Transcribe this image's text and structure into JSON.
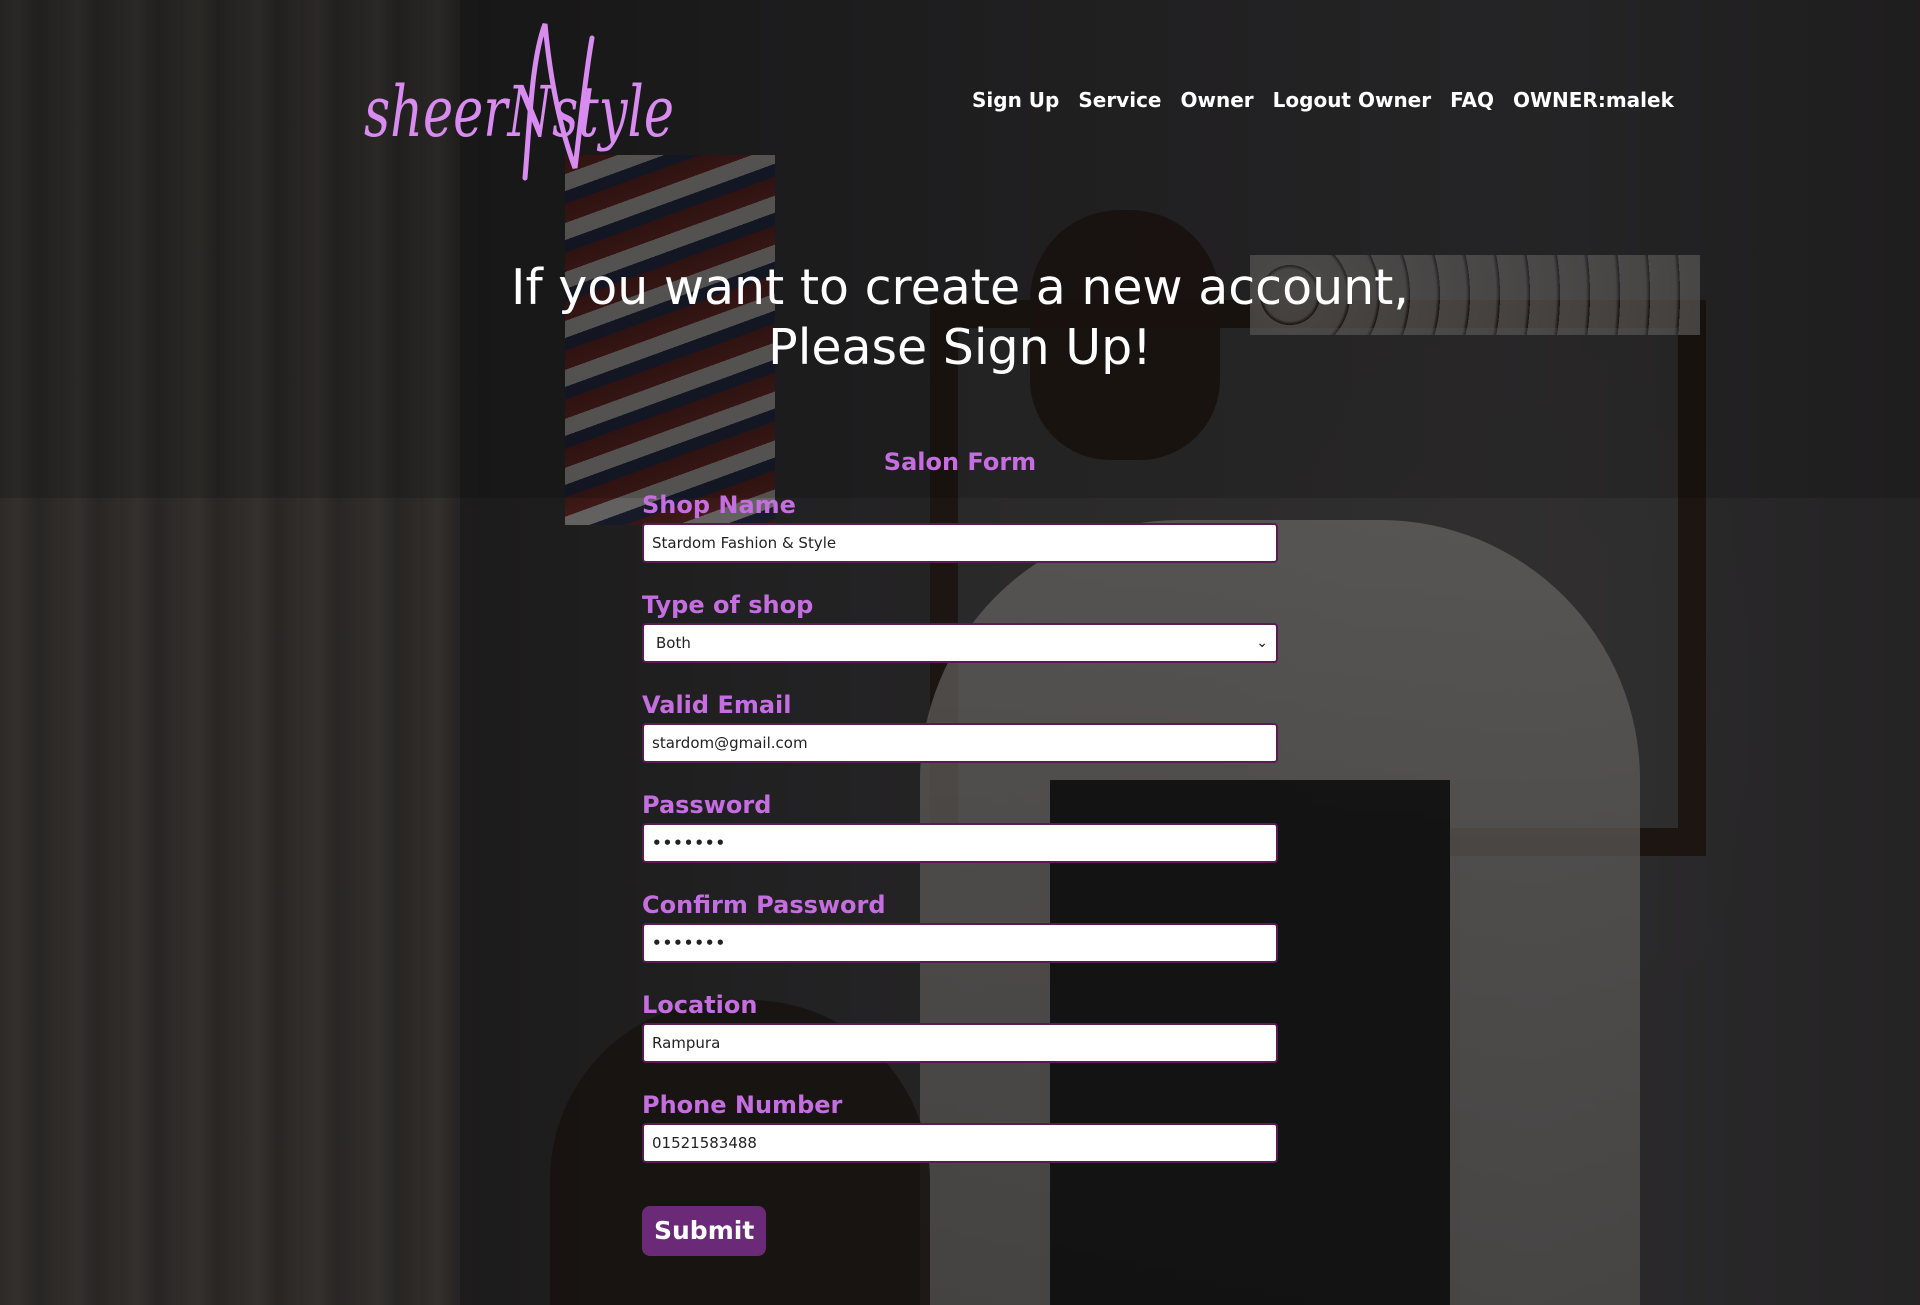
{
  "brand": {
    "logo_text": "sheerNstyle",
    "logo_color": "#d98cf0"
  },
  "nav": {
    "items": [
      {
        "label": "Sign Up"
      },
      {
        "label": "Service"
      },
      {
        "label": "Owner"
      },
      {
        "label": "Logout Owner"
      },
      {
        "label": "FAQ"
      },
      {
        "label": "OWNER:malek"
      }
    ]
  },
  "headline": {
    "line1": "If you want to create a new account,",
    "line2": "Please Sign Up!"
  },
  "form": {
    "title": "Salon Form",
    "fields": {
      "shop_name": {
        "label": "Shop Name",
        "value": "Stardom Fashion & Style"
      },
      "shop_type": {
        "label": "Type of shop",
        "value": "Both"
      },
      "email": {
        "label": "Valid Email",
        "value": "stardom@gmail.com"
      },
      "password": {
        "label": "Password",
        "value": "•••••••"
      },
      "confirm_password": {
        "label": "Confirm Password",
        "value": "•••••••"
      },
      "location": {
        "label": "Location",
        "value": "Rampura"
      },
      "phone": {
        "label": "Phone Number",
        "value": "01521583488"
      }
    },
    "submit_label": "Submit"
  },
  "colors": {
    "accent": "#c56ee0",
    "button": "#6b2a77",
    "input_border": "#5a1a52"
  }
}
